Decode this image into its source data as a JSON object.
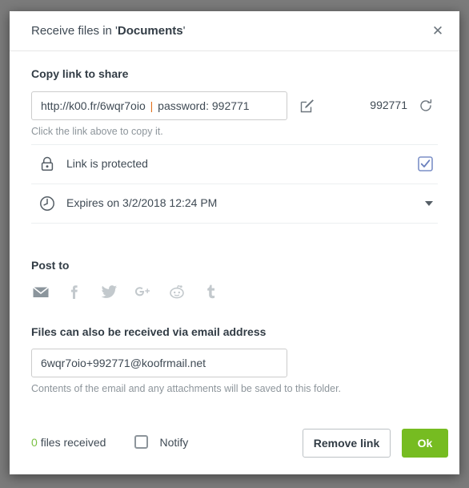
{
  "modal": {
    "title_prefix": "Receive files in '",
    "title_folder": "Documents",
    "title_suffix": "'",
    "close_icon": "close-icon"
  },
  "copy_link": {
    "section_label": "Copy link to share",
    "link_url": "http://k00.fr/6wqr7oio",
    "link_separator": "|",
    "link_password": "password: 992771",
    "edit_icon": "edit-icon",
    "code": "992771",
    "refresh_icon": "refresh-icon",
    "hint": "Click the link above to copy it."
  },
  "options": {
    "protected": {
      "icon": "lock-icon",
      "label": "Link is protected",
      "checked": true
    },
    "expires": {
      "icon": "clock-icon",
      "label": "Expires on 3/2/2018 12:24 PM",
      "caret_icon": "chevron-down-icon"
    }
  },
  "post_to": {
    "section_label": "Post to",
    "items": [
      {
        "name": "email-share-icon",
        "label": "Email"
      },
      {
        "name": "facebook-share-icon",
        "label": "Facebook"
      },
      {
        "name": "twitter-share-icon",
        "label": "Twitter"
      },
      {
        "name": "googleplus-share-icon",
        "label": "Google Plus"
      },
      {
        "name": "reddit-share-icon",
        "label": "Reddit"
      },
      {
        "name": "tumblr-share-icon",
        "label": "Tumblr"
      }
    ]
  },
  "email_section": {
    "section_label": "Files can also be received via email address",
    "email_value": "6wqr7oio+992771@koofrmail.net",
    "hint": "Contents of the email and any attachments will be saved to this folder."
  },
  "footer": {
    "files_count": "0",
    "files_received_label": "files received",
    "notify_label": "Notify",
    "notify_checked": false,
    "remove_link_label": "Remove link",
    "ok_label": "Ok"
  },
  "colors": {
    "accent_green": "#76bc21",
    "count_green": "#7ac043",
    "separator_orange": "#e2711d",
    "checkbox_blue": "#7b8fc7",
    "text_dark": "#3f4a54",
    "text_muted": "#8d959b",
    "backdrop": "#7b7b7b"
  }
}
